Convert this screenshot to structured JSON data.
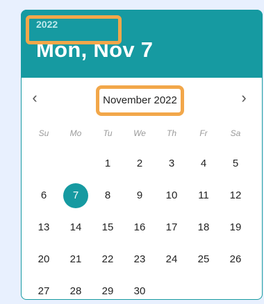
{
  "header": {
    "year": "2022",
    "date_title": "Mon, Nov 7"
  },
  "nav": {
    "prev": "‹",
    "next": "›",
    "month_label": "November 2022"
  },
  "weekdays": [
    "Su",
    "Mo",
    "Tu",
    "We",
    "Th",
    "Fr",
    "Sa"
  ],
  "days": [
    [
      "",
      "",
      "1",
      "2",
      "3",
      "4",
      "5"
    ],
    [
      "6",
      "7",
      "8",
      "9",
      "10",
      "11",
      "12"
    ],
    [
      "13",
      "14",
      "15",
      "16",
      "17",
      "18",
      "19"
    ],
    [
      "20",
      "21",
      "22",
      "23",
      "24",
      "25",
      "26"
    ],
    [
      "27",
      "28",
      "29",
      "30",
      "",
      "",
      ""
    ]
  ],
  "selected_day": "7",
  "colors": {
    "accent": "#169aa1",
    "highlight": "#f2a74a"
  }
}
